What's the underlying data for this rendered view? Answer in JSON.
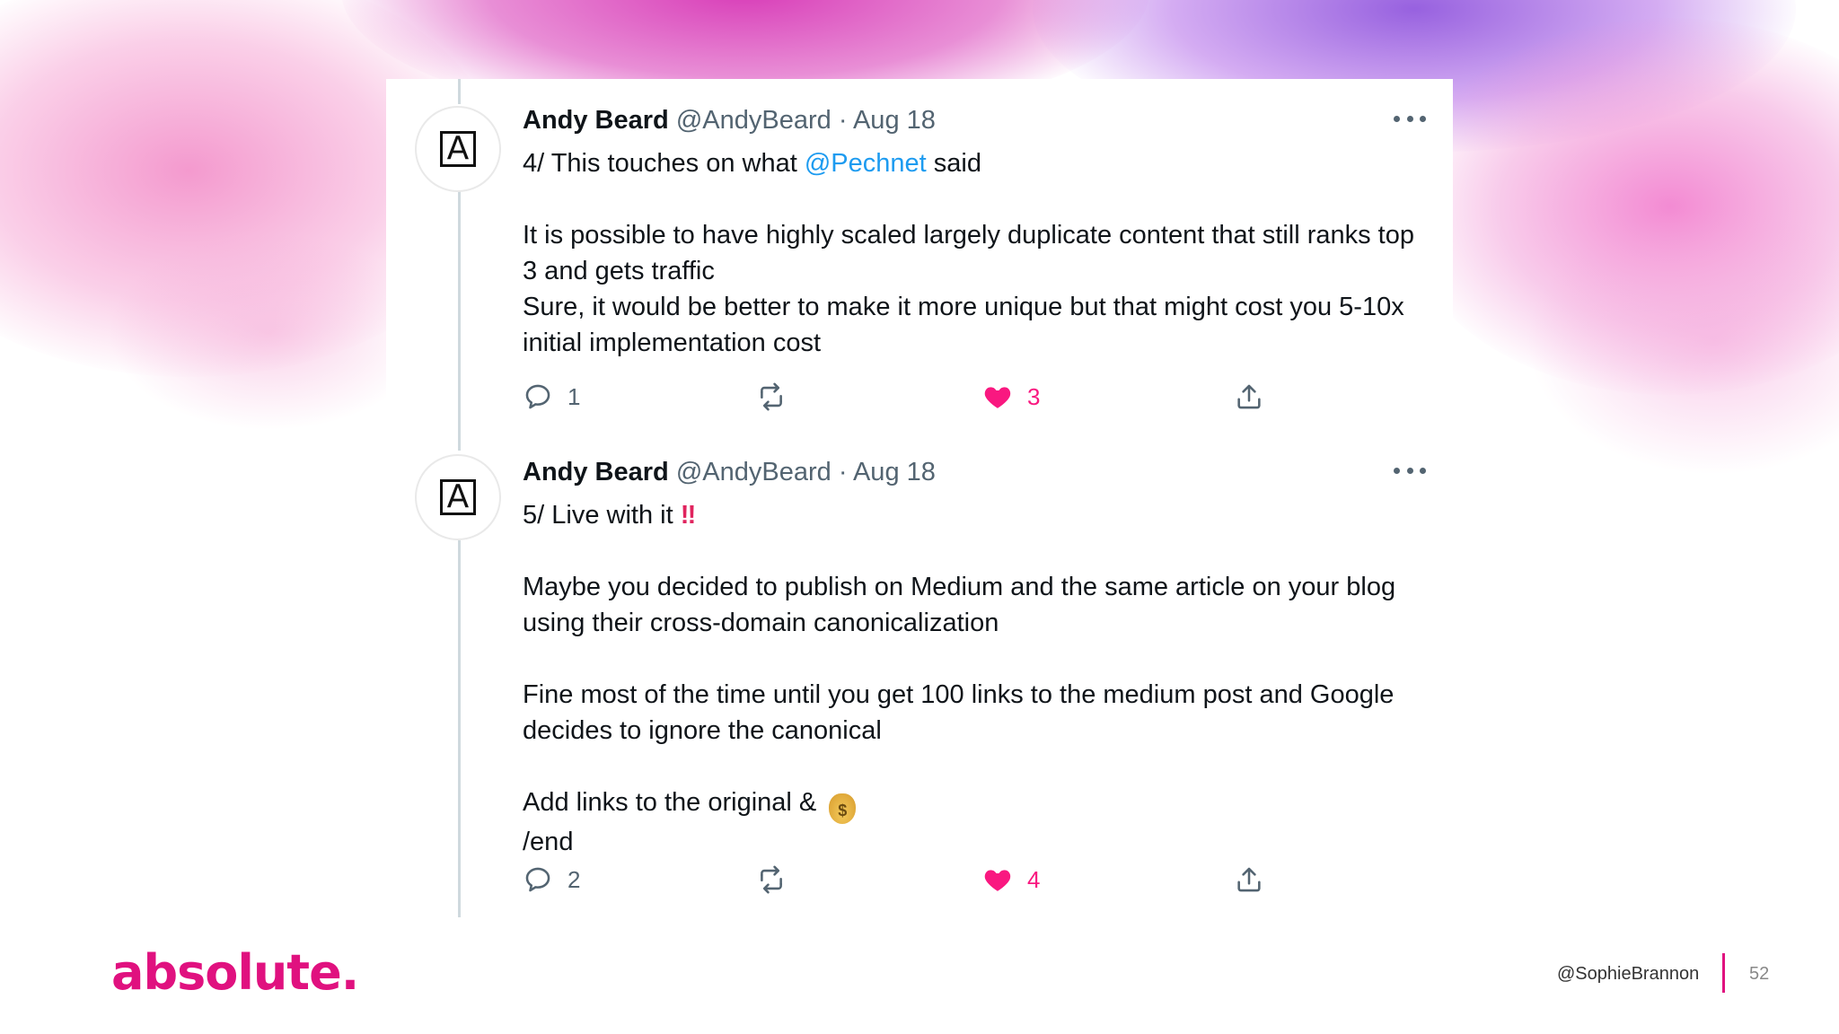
{
  "colors": {
    "brand_pink": "#e0117f",
    "mention_blue": "#1d9bf0",
    "like_red": "#f91880",
    "secondary_text": "#536471"
  },
  "tweets": [
    {
      "author_name": "Andy Beard",
      "handle": "@AndyBeard",
      "separator": "·",
      "date": "Aug 18",
      "line1_pre": "4/ This touches on what ",
      "line1_mention": "@Pechnet",
      "line1_post": " said",
      "paragraphs": [
        "It is possible to have highly scaled largely duplicate content that still ranks top 3 and gets traffic",
        "Sure, it would be better to make it more unique but that might cost you 5-10x initial implementation cost"
      ],
      "replies": "1",
      "retweets": "",
      "likes": "3",
      "liked": true
    },
    {
      "author_name": "Andy Beard",
      "handle": "@AndyBeard",
      "separator": "·",
      "date": "Aug 18",
      "line1": "5/ Live with it ",
      "line1_emoji": "‼",
      "para1": "Maybe you decided to publish on Medium and the same article on your blog using their cross-domain canonicalization",
      "para2": "Fine most of the time until you get 100 links to the medium post and Google decides to ignore the canonical",
      "para3_line1": "Add links to the original & ",
      "para3_emoji": "money-bag-emoji",
      "para3_emoji_glyph": "$",
      "para3_line2": "/end",
      "replies": "2",
      "retweets": "",
      "likes": "4",
      "liked": true
    }
  ],
  "icons": {
    "reply": "reply-icon",
    "retweet": "retweet-icon",
    "like": "heart-icon",
    "share": "share-icon",
    "more": "more-options-icon",
    "avatar": "letter-a-avatar"
  },
  "avatar_letter": "A",
  "footer": {
    "logo_text": "absolute.",
    "handle": "@SophieBrannon",
    "page_number": "52"
  }
}
